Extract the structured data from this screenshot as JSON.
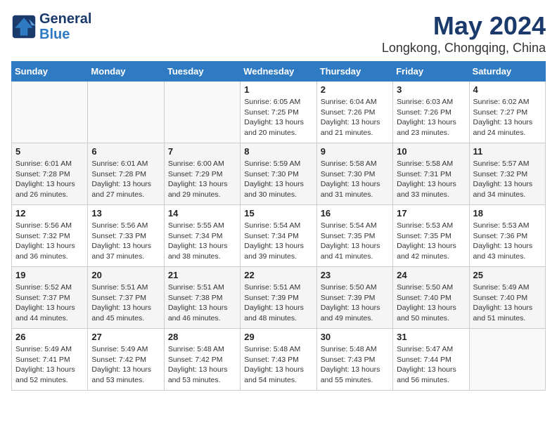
{
  "header": {
    "logo_line1": "General",
    "logo_line2": "Blue",
    "month": "May 2024",
    "location": "Longkong, Chongqing, China"
  },
  "days_of_week": [
    "Sunday",
    "Monday",
    "Tuesday",
    "Wednesday",
    "Thursday",
    "Friday",
    "Saturday"
  ],
  "weeks": [
    [
      {
        "day": "",
        "content": ""
      },
      {
        "day": "",
        "content": ""
      },
      {
        "day": "",
        "content": ""
      },
      {
        "day": "1",
        "content": "Sunrise: 6:05 AM\nSunset: 7:25 PM\nDaylight: 13 hours and 20 minutes."
      },
      {
        "day": "2",
        "content": "Sunrise: 6:04 AM\nSunset: 7:26 PM\nDaylight: 13 hours and 21 minutes."
      },
      {
        "day": "3",
        "content": "Sunrise: 6:03 AM\nSunset: 7:26 PM\nDaylight: 13 hours and 23 minutes."
      },
      {
        "day": "4",
        "content": "Sunrise: 6:02 AM\nSunset: 7:27 PM\nDaylight: 13 hours and 24 minutes."
      }
    ],
    [
      {
        "day": "5",
        "content": "Sunrise: 6:01 AM\nSunset: 7:28 PM\nDaylight: 13 hours and 26 minutes."
      },
      {
        "day": "6",
        "content": "Sunrise: 6:01 AM\nSunset: 7:28 PM\nDaylight: 13 hours and 27 minutes."
      },
      {
        "day": "7",
        "content": "Sunrise: 6:00 AM\nSunset: 7:29 PM\nDaylight: 13 hours and 29 minutes."
      },
      {
        "day": "8",
        "content": "Sunrise: 5:59 AM\nSunset: 7:30 PM\nDaylight: 13 hours and 30 minutes."
      },
      {
        "day": "9",
        "content": "Sunrise: 5:58 AM\nSunset: 7:30 PM\nDaylight: 13 hours and 31 minutes."
      },
      {
        "day": "10",
        "content": "Sunrise: 5:58 AM\nSunset: 7:31 PM\nDaylight: 13 hours and 33 minutes."
      },
      {
        "day": "11",
        "content": "Sunrise: 5:57 AM\nSunset: 7:32 PM\nDaylight: 13 hours and 34 minutes."
      }
    ],
    [
      {
        "day": "12",
        "content": "Sunrise: 5:56 AM\nSunset: 7:32 PM\nDaylight: 13 hours and 36 minutes."
      },
      {
        "day": "13",
        "content": "Sunrise: 5:56 AM\nSunset: 7:33 PM\nDaylight: 13 hours and 37 minutes."
      },
      {
        "day": "14",
        "content": "Sunrise: 5:55 AM\nSunset: 7:34 PM\nDaylight: 13 hours and 38 minutes."
      },
      {
        "day": "15",
        "content": "Sunrise: 5:54 AM\nSunset: 7:34 PM\nDaylight: 13 hours and 39 minutes."
      },
      {
        "day": "16",
        "content": "Sunrise: 5:54 AM\nSunset: 7:35 PM\nDaylight: 13 hours and 41 minutes."
      },
      {
        "day": "17",
        "content": "Sunrise: 5:53 AM\nSunset: 7:35 PM\nDaylight: 13 hours and 42 minutes."
      },
      {
        "day": "18",
        "content": "Sunrise: 5:53 AM\nSunset: 7:36 PM\nDaylight: 13 hours and 43 minutes."
      }
    ],
    [
      {
        "day": "19",
        "content": "Sunrise: 5:52 AM\nSunset: 7:37 PM\nDaylight: 13 hours and 44 minutes."
      },
      {
        "day": "20",
        "content": "Sunrise: 5:51 AM\nSunset: 7:37 PM\nDaylight: 13 hours and 45 minutes."
      },
      {
        "day": "21",
        "content": "Sunrise: 5:51 AM\nSunset: 7:38 PM\nDaylight: 13 hours and 46 minutes."
      },
      {
        "day": "22",
        "content": "Sunrise: 5:51 AM\nSunset: 7:39 PM\nDaylight: 13 hours and 48 minutes."
      },
      {
        "day": "23",
        "content": "Sunrise: 5:50 AM\nSunset: 7:39 PM\nDaylight: 13 hours and 49 minutes."
      },
      {
        "day": "24",
        "content": "Sunrise: 5:50 AM\nSunset: 7:40 PM\nDaylight: 13 hours and 50 minutes."
      },
      {
        "day": "25",
        "content": "Sunrise: 5:49 AM\nSunset: 7:40 PM\nDaylight: 13 hours and 51 minutes."
      }
    ],
    [
      {
        "day": "26",
        "content": "Sunrise: 5:49 AM\nSunset: 7:41 PM\nDaylight: 13 hours and 52 minutes."
      },
      {
        "day": "27",
        "content": "Sunrise: 5:49 AM\nSunset: 7:42 PM\nDaylight: 13 hours and 53 minutes."
      },
      {
        "day": "28",
        "content": "Sunrise: 5:48 AM\nSunset: 7:42 PM\nDaylight: 13 hours and 53 minutes."
      },
      {
        "day": "29",
        "content": "Sunrise: 5:48 AM\nSunset: 7:43 PM\nDaylight: 13 hours and 54 minutes."
      },
      {
        "day": "30",
        "content": "Sunrise: 5:48 AM\nSunset: 7:43 PM\nDaylight: 13 hours and 55 minutes."
      },
      {
        "day": "31",
        "content": "Sunrise: 5:47 AM\nSunset: 7:44 PM\nDaylight: 13 hours and 56 minutes."
      },
      {
        "day": "",
        "content": ""
      }
    ]
  ]
}
